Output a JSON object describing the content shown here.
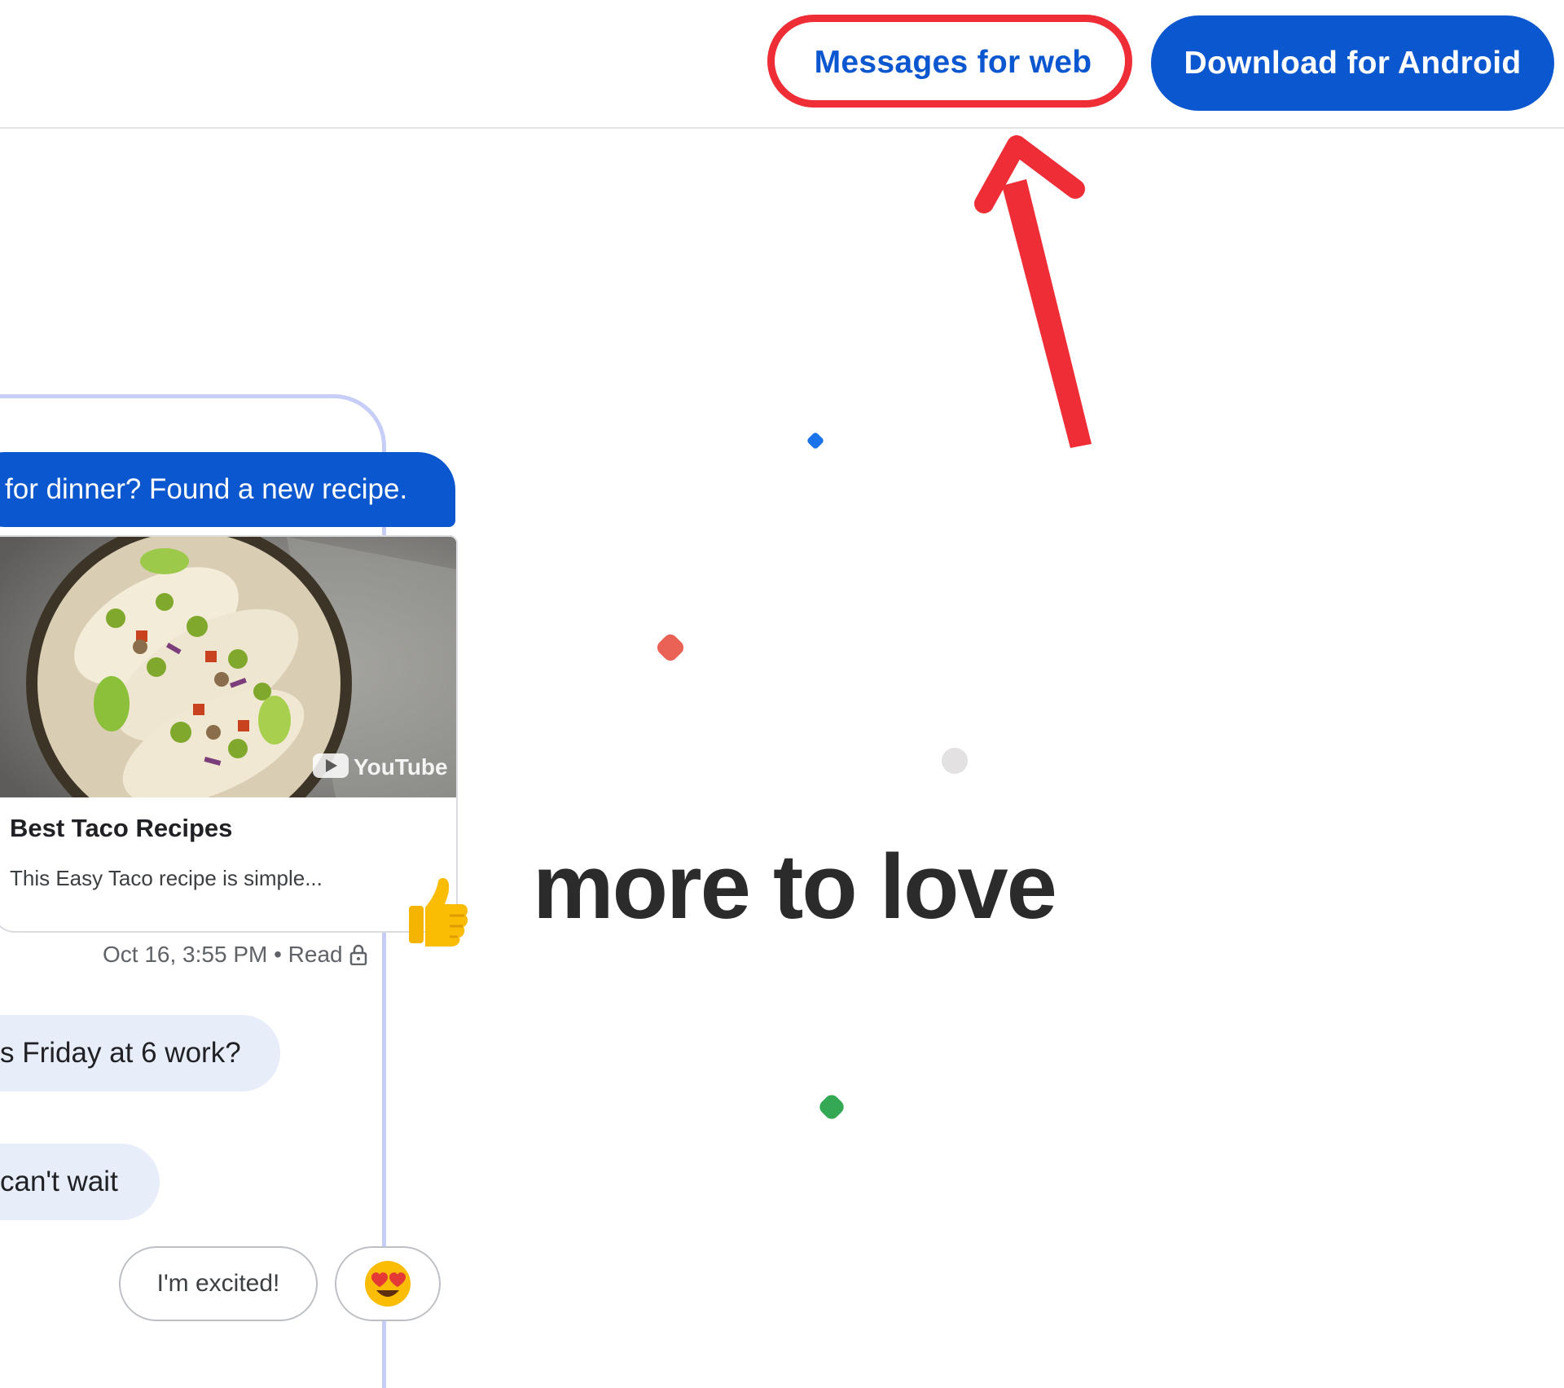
{
  "header": {
    "messages_for_web_label": "Messages for web",
    "download_label": "Download for Android"
  },
  "chat": {
    "outgoing_message": "for dinner? Found a new recipe.",
    "link_card": {
      "image_watermark": "YouTube",
      "title": "Best Taco Recipes",
      "description": "This Easy Taco recipe is simple..."
    },
    "reaction_emoji": "👍",
    "meta": "Oct 16, 3:55 PM • Read",
    "incoming_messages": [
      "s Friday at 6 work?",
      "can't wait"
    ],
    "suggested_replies": [
      "I'm excited!",
      "😍"
    ]
  },
  "headline": "more to love",
  "colors": {
    "primary_blue": "#0b57d0",
    "highlight_red": "#ee2d36",
    "dot_blue": "#1a73e8",
    "dot_red": "#ea6155",
    "dot_grey": "#e3e1e1",
    "dot_green": "#34a853"
  },
  "icons": [
    "arrow-up-icon",
    "lock-icon",
    "thumbs-up-icon",
    "youtube-logo-icon"
  ]
}
